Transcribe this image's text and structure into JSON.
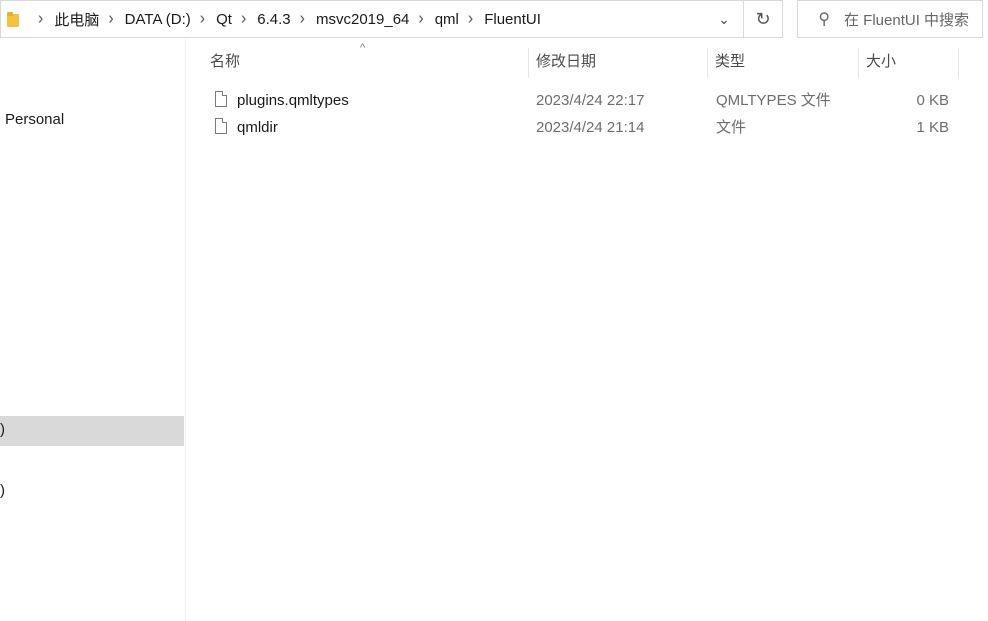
{
  "address_bar": {
    "breadcrumbs": [
      "此电脑",
      "DATA (D:)",
      "Qt",
      "6.4.3",
      "msvc2019_64",
      "qml",
      "FluentUI"
    ],
    "separator": "›",
    "dropdown_glyph": "⌄",
    "refresh_glyph": "↻"
  },
  "search": {
    "placeholder": "在 FluentUI 中搜索",
    "icon": "search-icon"
  },
  "nav_pane": {
    "items": [
      {
        "label": "Personal",
        "selected": false
      },
      {
        "label": ")",
        "selected": true
      },
      {
        "label": ")",
        "selected": false
      }
    ]
  },
  "file_list": {
    "sort_indicator": "^",
    "columns": [
      "名称",
      "修改日期",
      "类型",
      "大小"
    ],
    "rows": [
      {
        "name": "plugins.qmltypes",
        "modified": "2023/4/24 22:17",
        "type": "QMLTYPES 文件",
        "size": "0 KB"
      },
      {
        "name": "qmldir",
        "modified": "2023/4/24 21:14",
        "type": "文件",
        "size": "1 KB"
      }
    ]
  },
  "colors": {
    "border": "#d9d9d9",
    "selected_nav": "#d9d9d9",
    "folder_icon": "#f3c33e",
    "secondary_text": "#6d6d6d"
  }
}
